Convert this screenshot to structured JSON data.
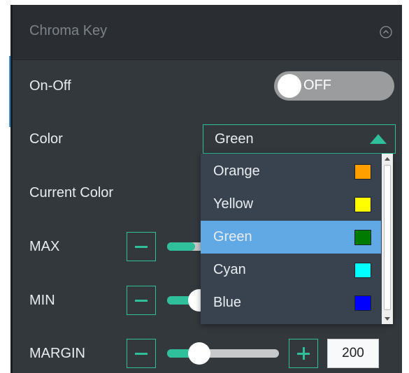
{
  "header": {
    "title": "Chroma Key",
    "collapse_icon": "collapse-up-icon"
  },
  "rows": {
    "onoff": {
      "label": "On-Off",
      "toggle_text": "OFF",
      "state": "off"
    },
    "color": {
      "label": "Color",
      "selected": "Green"
    },
    "current_color": {
      "label": "Current Color"
    },
    "max": {
      "label": "MAX",
      "level": 0.2
    },
    "min": {
      "label": "MIN",
      "level": 0.24
    },
    "margin": {
      "label": "MARGIN",
      "level": 0.24,
      "value": "200"
    }
  },
  "dropdown": {
    "options": [
      {
        "label": "Orange",
        "swatch": "#ff9f00"
      },
      {
        "label": "Yellow",
        "swatch": "#ffff00"
      },
      {
        "label": "Green",
        "swatch": "#007a00",
        "selected": true
      },
      {
        "label": "Cyan",
        "swatch": "#00ffff"
      },
      {
        "label": "Blue",
        "swatch": "#0000ff"
      }
    ]
  },
  "colors": {
    "accent": "#2fbf9a",
    "panel_bg": "#33383d",
    "header_bg": "#2a2e32",
    "dropdown_bg": "#394350",
    "selection": "#60a9e5"
  }
}
